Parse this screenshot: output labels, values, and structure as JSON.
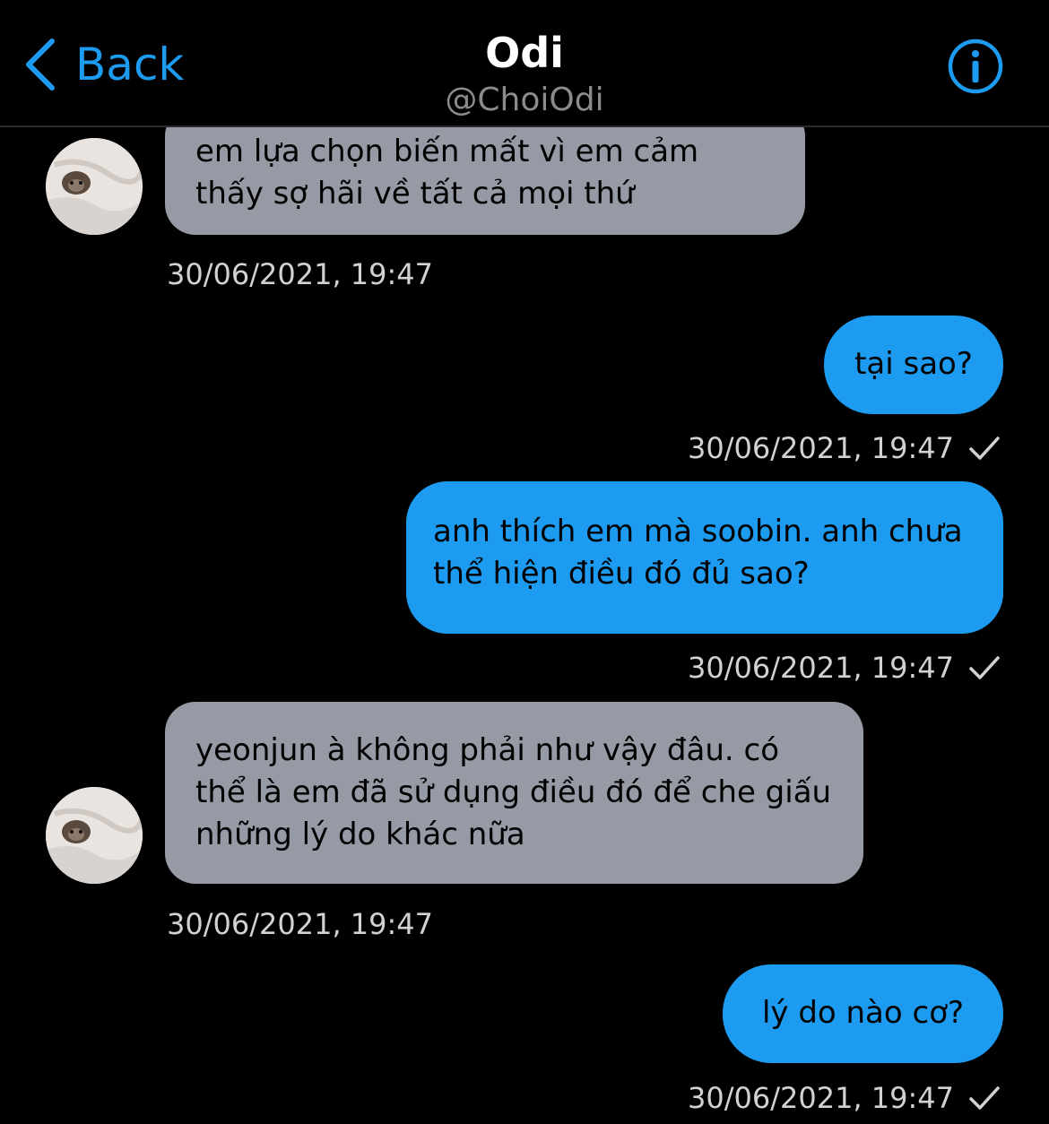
{
  "header": {
    "back_label": "Back",
    "title": "Odi",
    "handle": "@ChoiOdi",
    "back_icon": "chevron-left-icon",
    "info_icon": "info-icon",
    "accent": "#1d9bf0"
  },
  "messages": [
    {
      "direction": "in",
      "text": "em lựa chọn biến mất vì em cảm thấy sợ hãi về tất cả mọi thứ",
      "timestamp": "30/06/2021, 19:47"
    },
    {
      "direction": "out",
      "text": "tại sao?",
      "timestamp": "30/06/2021, 19:47"
    },
    {
      "direction": "out",
      "text": "anh thích em mà soobin. anh chưa thể hiện điều đó đủ sao?",
      "timestamp": "30/06/2021, 19:47"
    },
    {
      "direction": "in",
      "text": "yeonjun à không phải như vậy đâu. có thể là em đã sử dụng điều đó để che giấu những lý do khác nữa",
      "timestamp": "30/06/2021, 19:47"
    },
    {
      "direction": "out",
      "text": "lý do nào cơ?",
      "timestamp": "30/06/2021, 19:47"
    }
  ],
  "colors": {
    "incoming_bubble": "#969aa5",
    "outgoing_bubble": "#1d9bf0",
    "background": "#000000"
  }
}
